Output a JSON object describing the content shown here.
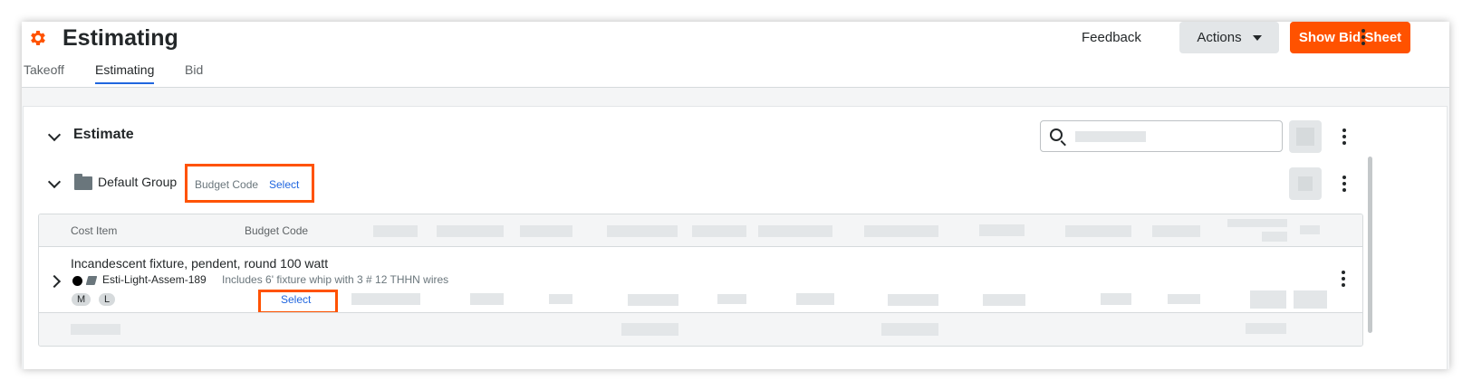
{
  "header": {
    "title": "Estimating",
    "tabs": [
      {
        "label": "Takeoff",
        "active": false
      },
      {
        "label": "Estimating",
        "active": true
      },
      {
        "label": "Bid",
        "active": false
      }
    ],
    "feedback_label": "Feedback",
    "actions_label": "Actions",
    "show_bid_sheet_label": "Show Bid Sheet"
  },
  "estimate": {
    "title": "Estimate",
    "search": {
      "placeholder": ""
    }
  },
  "group": {
    "name": "Default Group",
    "budget_code_label": "Budget Code",
    "budget_code_select": "Select"
  },
  "table": {
    "columns": [
      "Cost Item",
      "Budget Code"
    ],
    "row": {
      "name": "Incandescent fixture, pendent, round 100 watt",
      "code": "Esti-Light-Assem-189",
      "description": "Includes 6' fixture whip with 3 # 12 THHN wires",
      "tags": [
        "M",
        "L"
      ],
      "budget_code_select": "Select"
    }
  },
  "colors": {
    "brand_orange": "#ff5200",
    "link_blue": "#2066df",
    "placeholder_gray": "#e3e6e8"
  }
}
